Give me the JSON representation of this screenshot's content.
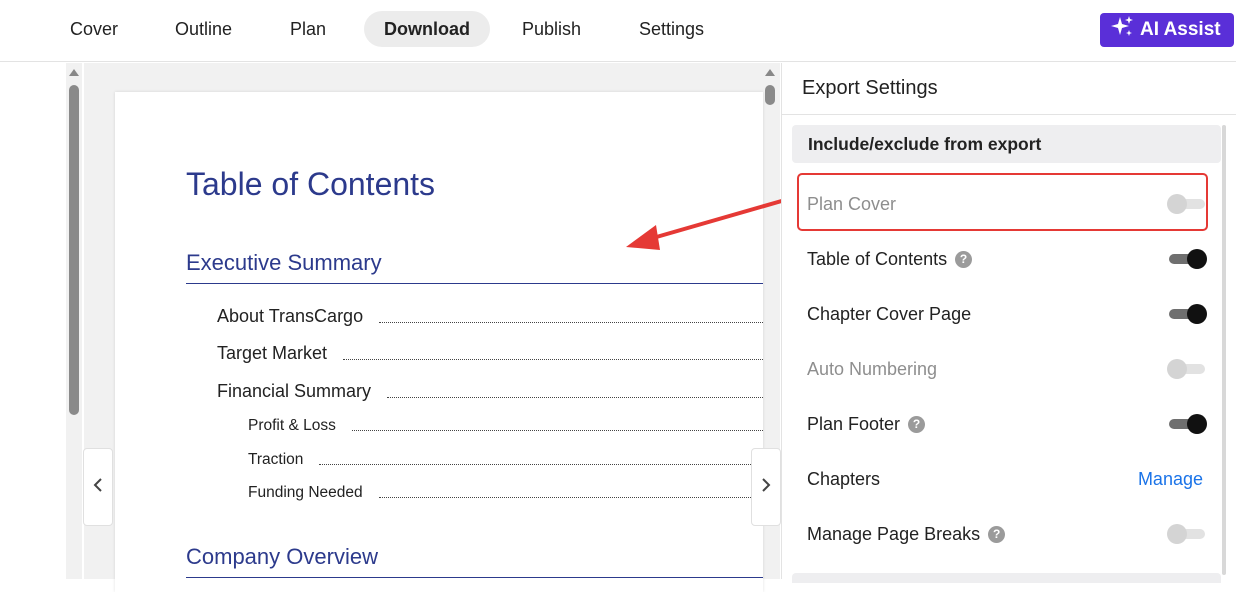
{
  "nav": {
    "tabs": [
      {
        "label": "Cover"
      },
      {
        "label": "Outline"
      },
      {
        "label": "Plan"
      },
      {
        "label": "Download"
      },
      {
        "label": "Publish"
      },
      {
        "label": "Settings"
      }
    ],
    "active_tab": "Download",
    "ai_assist_label": "AI Assist",
    "accent_color": "#5a2fd8"
  },
  "preview": {
    "toc_title": "Table of Contents",
    "sections": [
      {
        "heading": "Executive Summary",
        "items": [
          {
            "label": "About TransCargo",
            "level": 1
          },
          {
            "label": "Target Market",
            "level": 1
          },
          {
            "label": "Financial Summary",
            "level": 1
          },
          {
            "label": "Profit & Loss",
            "level": 2
          },
          {
            "label": "Traction",
            "level": 2
          },
          {
            "label": "Funding Needed",
            "level": 2
          }
        ]
      },
      {
        "heading": "Company Overview",
        "items": []
      }
    ],
    "heading_color": "#2c3a8c",
    "prev_icon": "chevron-left-icon",
    "next_icon": "chevron-right-icon"
  },
  "export_settings": {
    "title": "Export Settings",
    "section_header": "Include/exclude from export",
    "options": [
      {
        "label": "Plan Cover",
        "toggle": "off",
        "disabled": true,
        "help": false
      },
      {
        "label": "Table of Contents",
        "toggle": "on",
        "disabled": false,
        "help": true
      },
      {
        "label": "Chapter Cover Page",
        "toggle": "on",
        "disabled": false,
        "help": false
      },
      {
        "label": "Auto Numbering",
        "toggle": "off",
        "disabled": true,
        "help": false
      },
      {
        "label": "Plan Footer",
        "toggle": "on",
        "disabled": false,
        "help": true
      },
      {
        "label": "Chapters",
        "link": "Manage",
        "disabled": false,
        "help": false
      },
      {
        "label": "Manage Page Breaks",
        "toggle": "off",
        "disabled": false,
        "help": true
      }
    ],
    "help_glyph": "?",
    "link_color": "#1a73e8",
    "highlight_color": "#e53935"
  }
}
